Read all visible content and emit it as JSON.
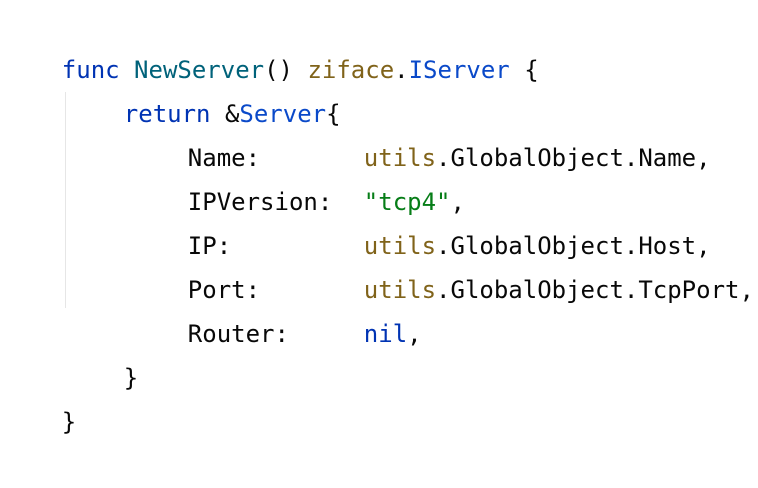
{
  "editor": {
    "colors": {
      "background": "#ffffff",
      "keyword": "#0033b3",
      "function_name": "#00627a",
      "package": "#80631a",
      "type": "#0a49c9",
      "string": "#067d17",
      "plain": "#080808"
    },
    "lines": [
      {
        "tokens": [
          {
            "text": "func",
            "kind": "keyword"
          },
          {
            "text": " ",
            "kind": "plain"
          },
          {
            "text": "NewServer",
            "kind": "function_name"
          },
          {
            "text": "() ",
            "kind": "plain"
          },
          {
            "text": "ziface",
            "kind": "package"
          },
          {
            "text": ".",
            "kind": "plain"
          },
          {
            "text": "IServer",
            "kind": "type"
          },
          {
            "text": " {",
            "kind": "plain"
          }
        ]
      },
      {
        "tokens": [
          {
            "text": "return",
            "kind": "keyword"
          },
          {
            "text": " &",
            "kind": "plain"
          },
          {
            "text": "Server",
            "kind": "type"
          },
          {
            "text": "{",
            "kind": "plain"
          }
        ]
      },
      {
        "tokens": [
          {
            "text": "Name:",
            "kind": "plain"
          },
          {
            "text": "utils",
            "kind": "package"
          },
          {
            "text": ".GlobalObject.Name,",
            "kind": "plain"
          }
        ]
      },
      {
        "tokens": [
          {
            "text": "IPVersion:",
            "kind": "plain"
          },
          {
            "text": "\"tcp4\"",
            "kind": "string"
          },
          {
            "text": ",",
            "kind": "plain"
          }
        ]
      },
      {
        "tokens": [
          {
            "text": "IP:",
            "kind": "plain"
          },
          {
            "text": "utils",
            "kind": "package"
          },
          {
            "text": ".GlobalObject.Host,",
            "kind": "plain"
          }
        ]
      },
      {
        "tokens": [
          {
            "text": "Port:",
            "kind": "plain"
          },
          {
            "text": "utils",
            "kind": "package"
          },
          {
            "text": ".GlobalObject.TcpPort,",
            "kind": "plain"
          }
        ]
      },
      {
        "tokens": [
          {
            "text": "Router:",
            "kind": "plain"
          },
          {
            "text": "nil",
            "kind": "keyword"
          },
          {
            "text": ",",
            "kind": "plain"
          }
        ]
      },
      {
        "tokens": [
          {
            "text": "}",
            "kind": "plain"
          }
        ]
      },
      {
        "tokens": [
          {
            "text": "}",
            "kind": "plain"
          }
        ]
      }
    ]
  }
}
